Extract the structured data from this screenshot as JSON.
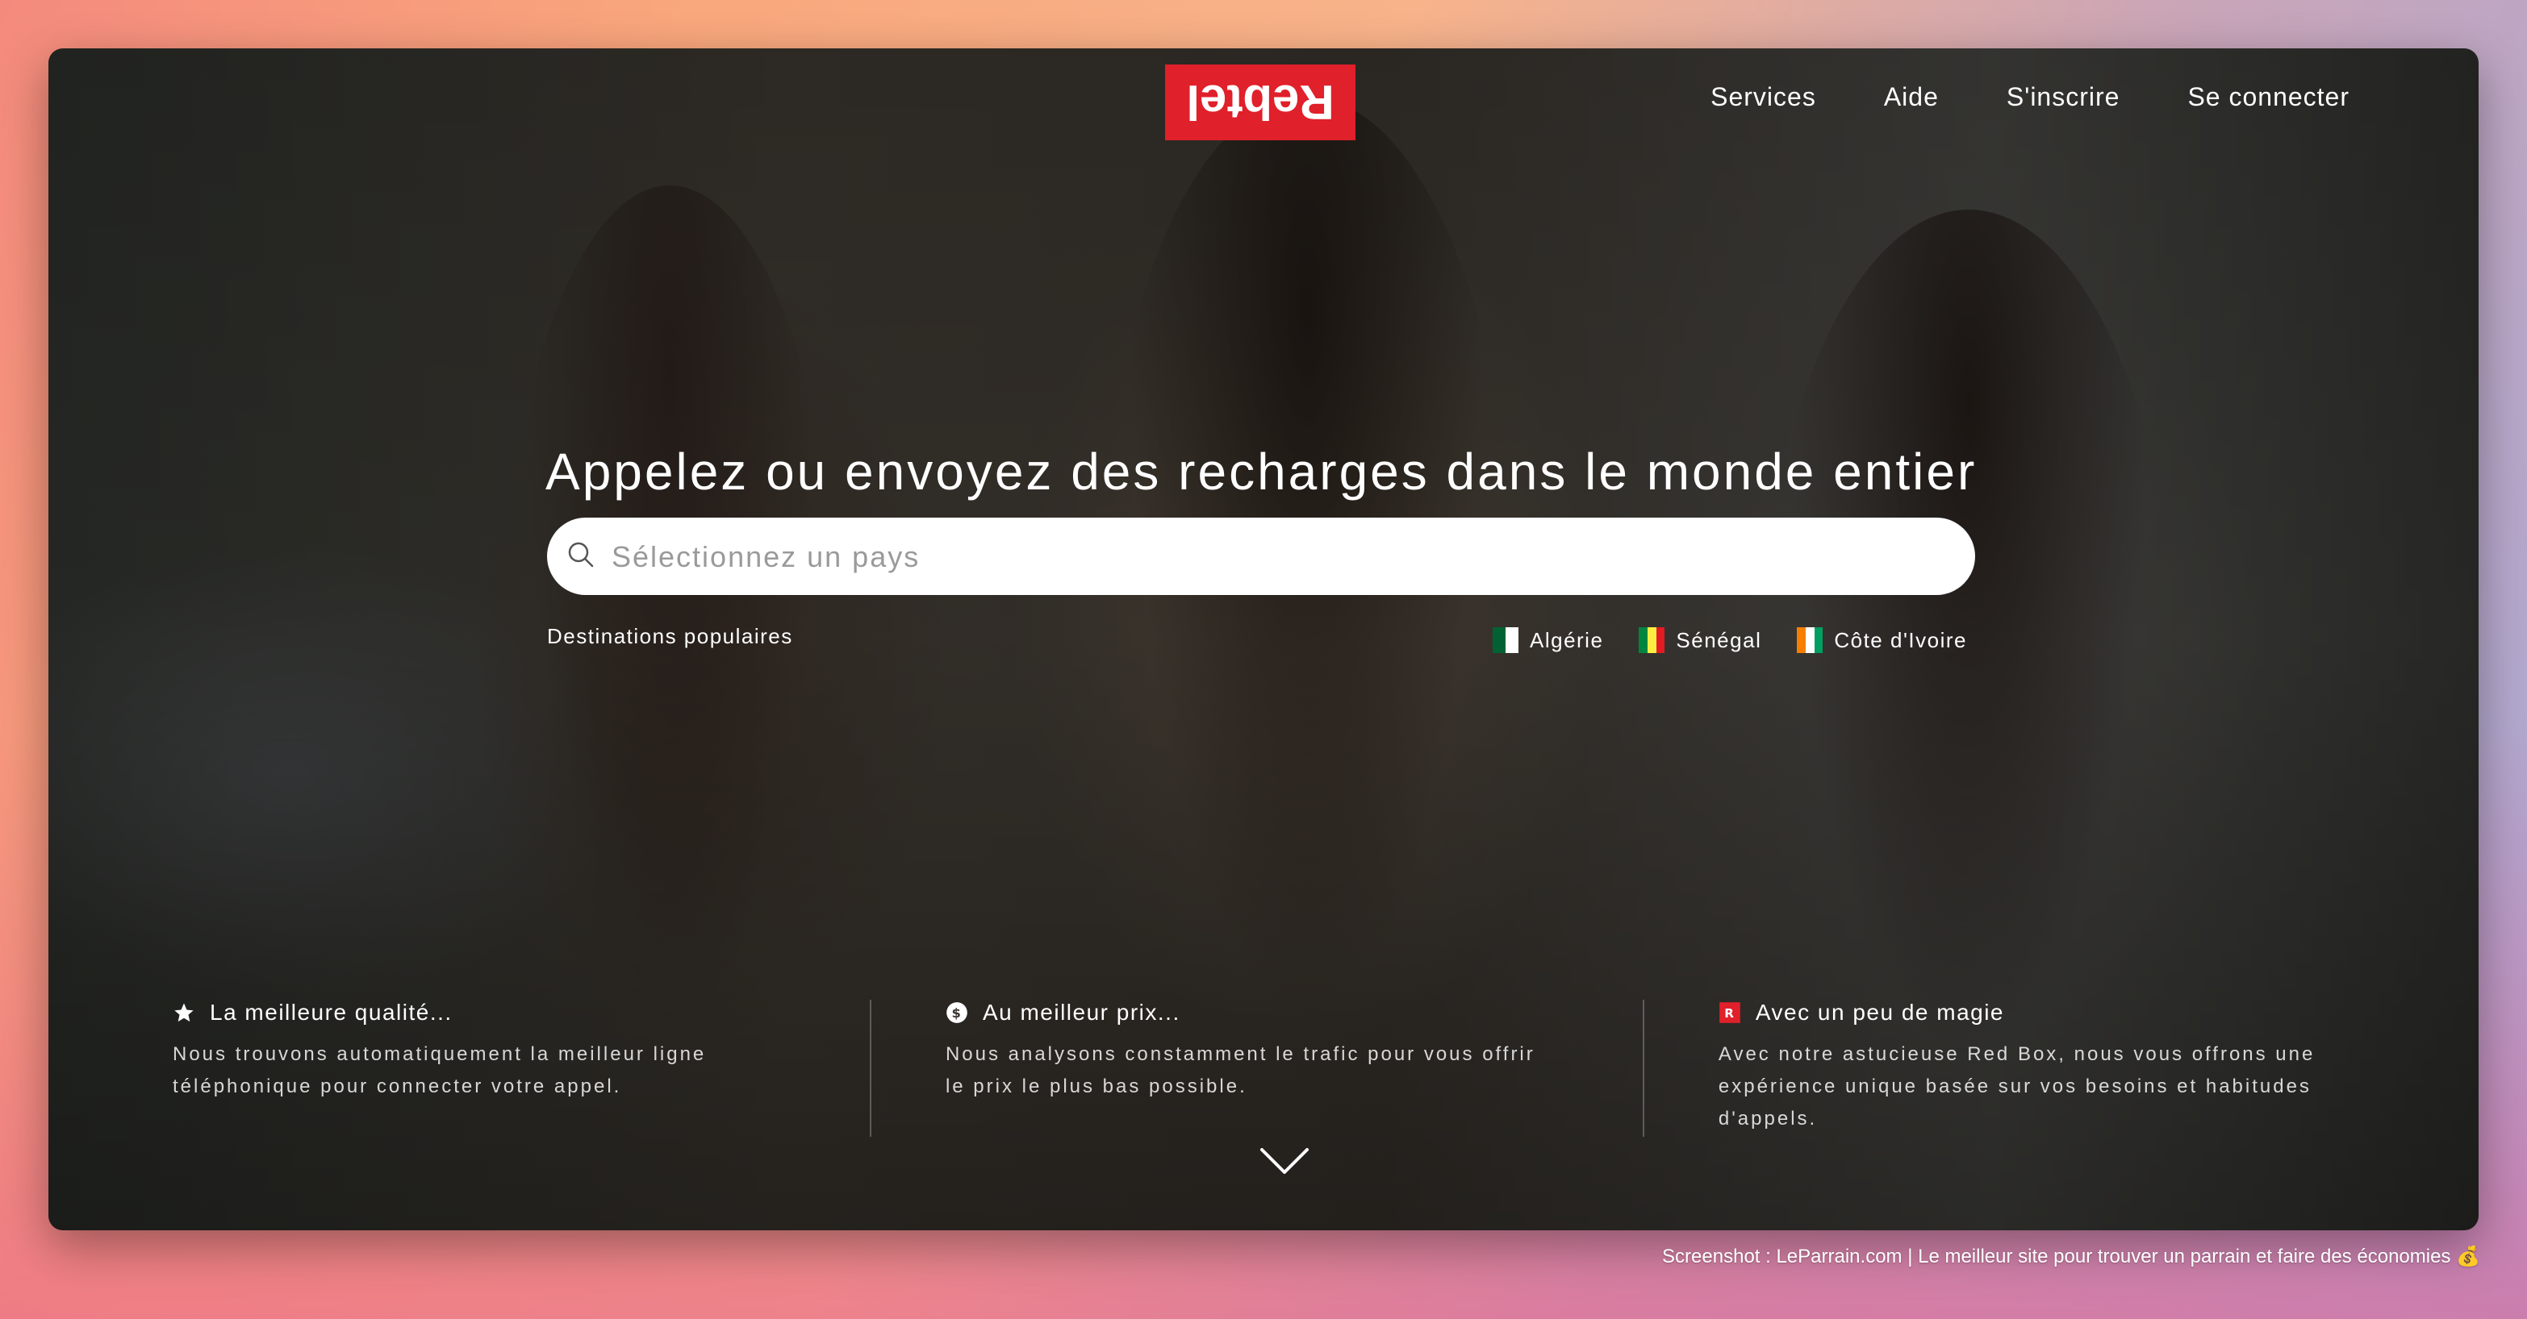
{
  "header": {
    "logo_text": "Rebtel",
    "nav": [
      "Services",
      "Aide",
      "S'inscrire",
      "Se connecter"
    ]
  },
  "hero": {
    "headline": "Appelez ou envoyez des recharges dans le monde entier",
    "search_placeholder": "Sélectionnez un pays",
    "popular_label": "Destinations populaires",
    "destinations": [
      {
        "name": "Algérie",
        "flag_colors": [
          "#006233",
          "#ffffff"
        ]
      },
      {
        "name": "Sénégal",
        "flag_colors": [
          "#00853f",
          "#fdef42",
          "#e31b23"
        ]
      },
      {
        "name": "Côte d'Ivoire",
        "flag_colors": [
          "#f77f00",
          "#ffffff",
          "#009e60"
        ]
      }
    ]
  },
  "features": [
    {
      "icon": "star-icon",
      "title": "La meilleure qualité...",
      "text": "Nous trouvons automatiquement la meilleur ligne téléphonique pour connecter votre appel."
    },
    {
      "icon": "dollar-icon",
      "title": "Au meilleur prix...",
      "text": "Nous analysons constamment le trafic pour vous offrir le prix le plus bas possible."
    },
    {
      "icon": "red-box-icon",
      "title": "Avec un peu de magie",
      "text": "Avec notre astucieuse Red Box, nous vous offrons une expérience unique basée sur vos besoins et habitudes d'appels."
    }
  ],
  "footer_caption": "Screenshot : LeParrain.com | Le meilleur site pour trouver un parrain et faire des économies 💰",
  "colors": {
    "brand_red": "#e0202a"
  }
}
